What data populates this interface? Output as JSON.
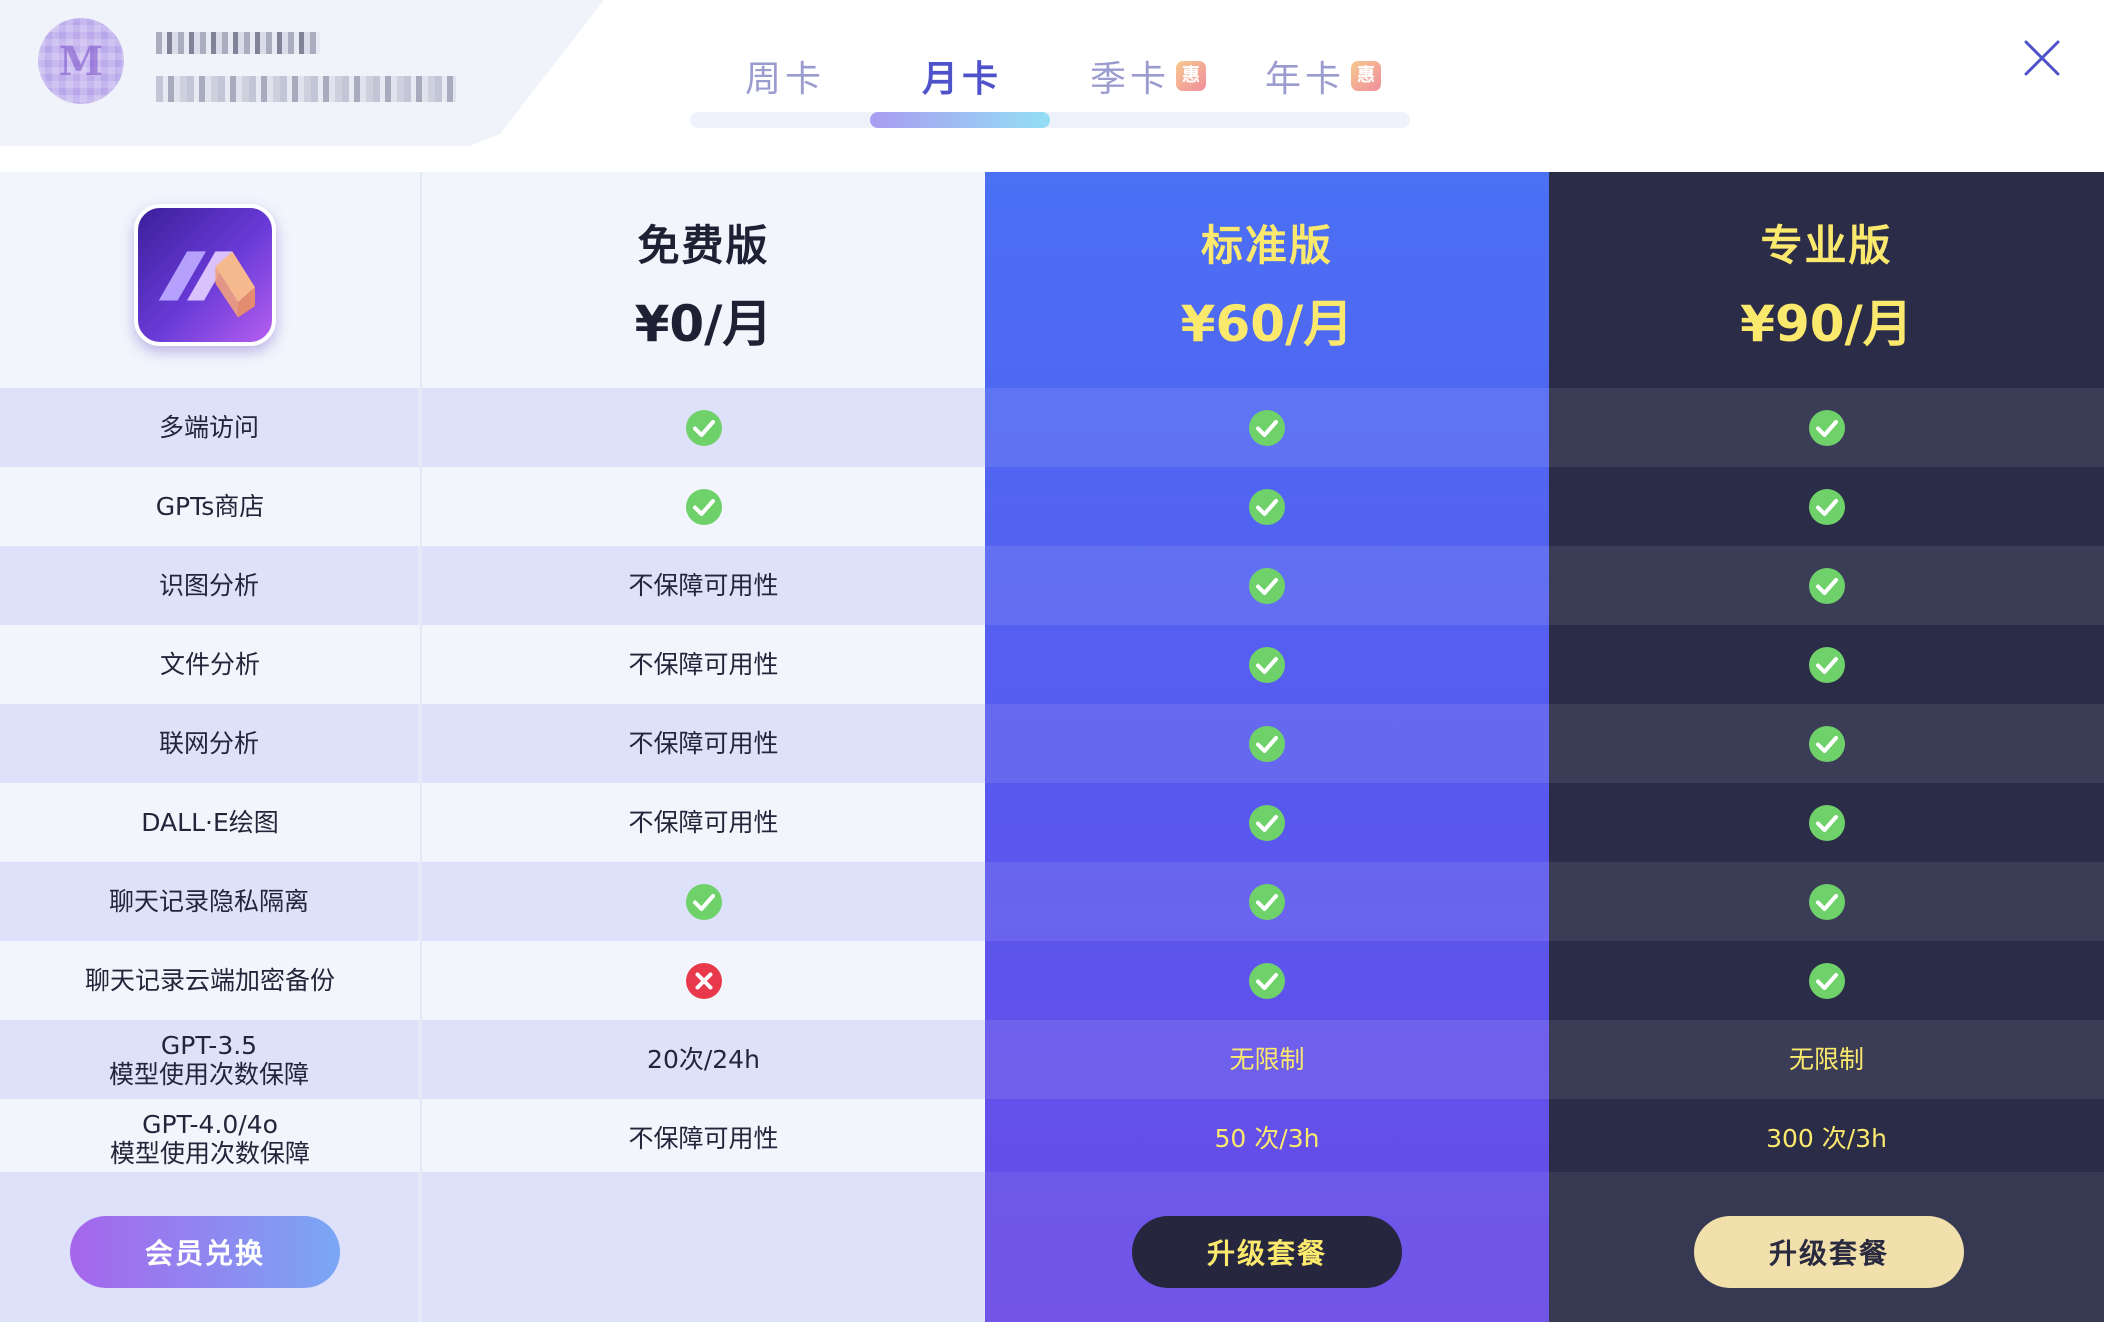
{
  "header": {
    "user": {
      "avatar_letter": "M"
    },
    "tabs": [
      {
        "label": "周卡",
        "badge": ""
      },
      {
        "label": "月卡",
        "badge": ""
      },
      {
        "label": "季卡",
        "badge": "惠"
      },
      {
        "label": "年卡",
        "badge": "惠"
      }
    ],
    "active_tab": "月卡"
  },
  "plans": [
    {
      "name": "免费版",
      "price": "¥0/月"
    },
    {
      "name": "标准版",
      "price": "¥60/月"
    },
    {
      "name": "专业版",
      "price": "¥90/月"
    }
  ],
  "features": [
    {
      "label": "多端访问",
      "free": "check",
      "standard": "check",
      "pro": "check"
    },
    {
      "label": "GPTs商店",
      "free": "check",
      "standard": "check",
      "pro": "check"
    },
    {
      "label": "识图分析",
      "free": "不保障可用性",
      "standard": "check",
      "pro": "check"
    },
    {
      "label": "文件分析",
      "free": "不保障可用性",
      "standard": "check",
      "pro": "check"
    },
    {
      "label": "联网分析",
      "free": "不保障可用性",
      "standard": "check",
      "pro": "check"
    },
    {
      "label": "DALL·E绘图",
      "free": "不保障可用性",
      "standard": "check",
      "pro": "check"
    },
    {
      "label": "聊天记录隐私隔离",
      "free": "check",
      "standard": "check",
      "pro": "check"
    },
    {
      "label": "聊天记录云端加密备份",
      "free": "cross",
      "standard": "check",
      "pro": "check"
    },
    {
      "label_line1": "GPT-3.5",
      "label_line2": "模型使用次数保障",
      "free": "20次/24h",
      "standard": "无限制",
      "pro": "无限制"
    },
    {
      "label_line1": "GPT-4.0/4o",
      "label_line2": "模型使用次数保障",
      "free": "不保障可用性",
      "standard": "50 次/3h",
      "pro": "300 次/3h"
    }
  ],
  "buttons": {
    "redeem": "会员兑换",
    "upgrade_standard": "升级套餐",
    "upgrade_pro": "升级套餐"
  },
  "colors": {
    "accent": "#4f53c9",
    "standard_bg": "#4a70f4",
    "pro_bg": "#2b2c47",
    "highlight_text": "#fbe96e",
    "check_green": "#6fd16a",
    "cross_red": "#e8394c"
  }
}
